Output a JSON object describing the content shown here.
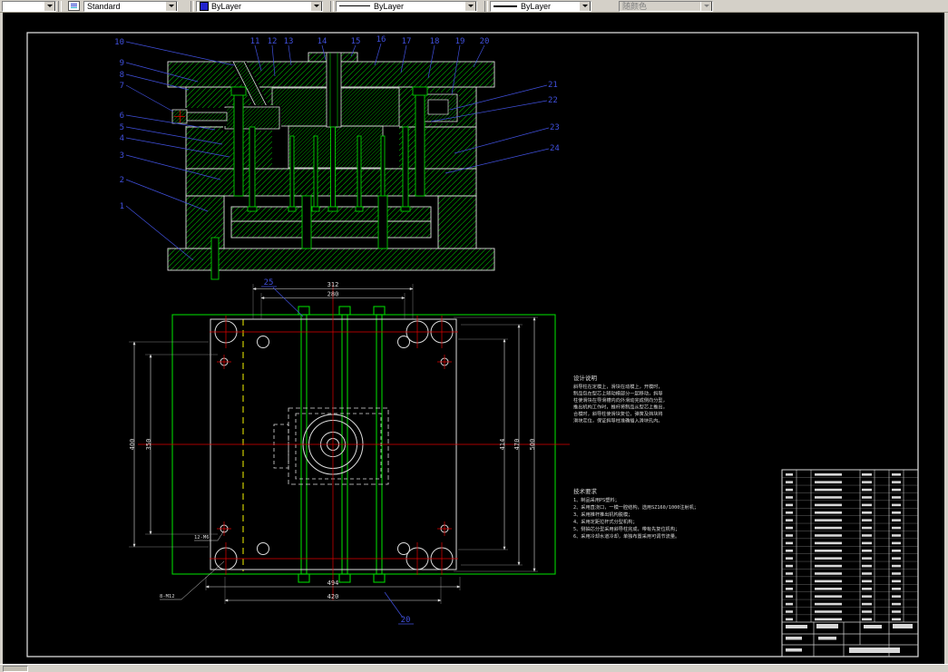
{
  "toolbar": {
    "style_label": "Standard",
    "color_label": "ByLayer",
    "linetype_label": "ByLayer",
    "lineweight_label": "ByLayer",
    "plotstyle_label": "随颜色"
  },
  "colors": {
    "hatch_green": "#00b800",
    "entity_green": "#00d200",
    "callout_blue": "#4050dd",
    "dim_white": "#dcdcdc",
    "center_red": "#e00000",
    "aux_yellow": "#cccc00"
  },
  "callouts": {
    "left": [
      "10",
      "9",
      "8",
      "7",
      "6",
      "5",
      "4",
      "3",
      "2",
      "1"
    ],
    "top": [
      "11",
      "12",
      "13",
      "14",
      "15",
      "16",
      "17",
      "18",
      "19",
      "20"
    ],
    "right": [
      "21",
      "22",
      "23",
      "24"
    ],
    "plan_top": "25",
    "plan_bottom": "20"
  },
  "dimensions": {
    "top": [
      "312",
      "280"
    ],
    "bottom": [
      "494",
      "420"
    ],
    "right": [
      "414",
      "470",
      "500"
    ],
    "left": [
      "400",
      "350"
    ],
    "hole_notes": [
      "12-M6",
      "8-M12"
    ]
  },
  "notes": {
    "title": "设计说明",
    "lines": [
      "斜导柱在定模上，滑块在动模上，开模时，",
      "制品包在型芯上随动模部分一起移动，斜导",
      "柱使滑块在导滑槽内向外滑动完成侧向分型，",
      "推出机构工作时，推杆将制品从型芯上推出，",
      "合模时，斜导柱使滑块复位，弹簧及挡块将",
      "滑块定位，保证斜导柱准确插入滑块孔内。"
    ]
  },
  "tech": {
    "title": "技术要求",
    "items": [
      "1、制品采用PS塑料；",
      "2、采用直浇口，一模一腔结构，选用SZ160/1000注射机；",
      "3、采用推杆推出机构脱模；",
      "4、采用定距拉杆式分型机构；",
      "5、侧抽芯分型采用斜导柱完成，带有先复位机构；",
      "6、采用冷却水道冷却，单独布置采用可调节流量。"
    ]
  }
}
